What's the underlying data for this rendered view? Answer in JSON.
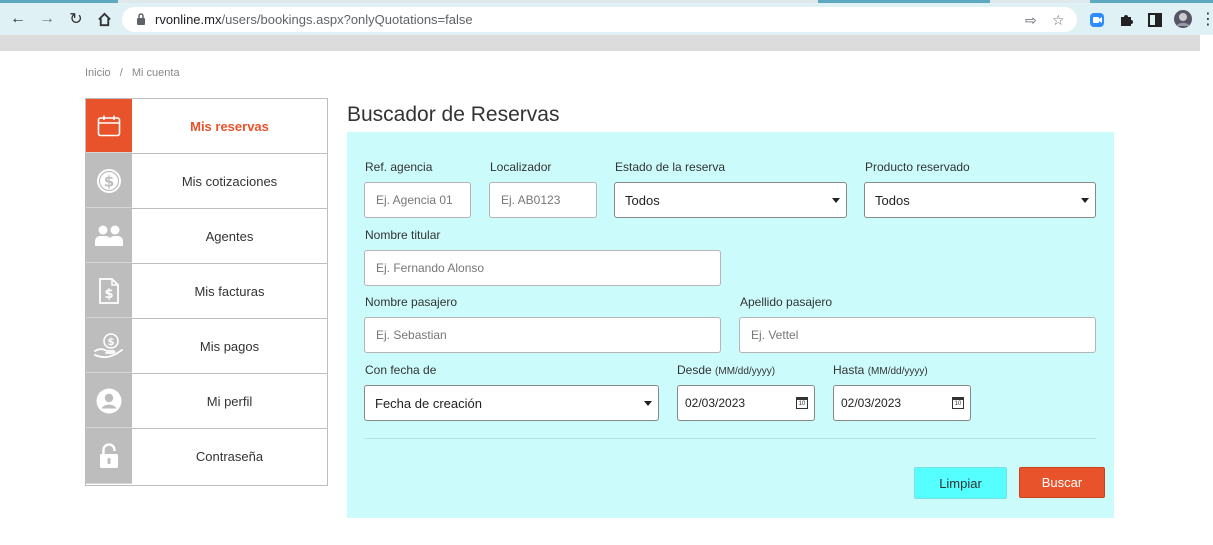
{
  "browser": {
    "url_host": "rvonline.mx",
    "url_path": "/users/bookings.aspx?onlyQuotations=false"
  },
  "breadcrumb": [
    "Inicio",
    "/",
    "Mi cuenta"
  ],
  "sidebar": {
    "items": [
      {
        "label": "Mis reservas",
        "icon": "calendar-icon",
        "active": true
      },
      {
        "label": "Mis cotizaciones",
        "icon": "dollar-coin-icon",
        "active": false
      },
      {
        "label": "Agentes",
        "icon": "people-icon",
        "active": false
      },
      {
        "label": "Mis facturas",
        "icon": "invoice-icon",
        "active": false
      },
      {
        "label": "Mis pagos",
        "icon": "hand-coin-icon",
        "active": false
      },
      {
        "label": "Mi perfil",
        "icon": "user-circle-icon",
        "active": false
      },
      {
        "label": "Contraseña",
        "icon": "lock-icon",
        "active": false
      }
    ]
  },
  "main": {
    "title": "Buscador de Reservas",
    "form": {
      "ref_agencia": {
        "label": "Ref. agencia",
        "placeholder": "Ej. Agencia 01"
      },
      "localizador": {
        "label": "Localizador",
        "placeholder": "Ej. AB0123"
      },
      "estado": {
        "label": "Estado de la reserva",
        "value": "Todos"
      },
      "producto": {
        "label": "Producto reservado",
        "value": "Todos"
      },
      "nombre_titular": {
        "label": "Nombre titular",
        "placeholder": "Ej. Fernando Alonso"
      },
      "nombre_pasajero": {
        "label": "Nombre pasajero",
        "placeholder": "Ej. Sebastian"
      },
      "apellido_pasajero": {
        "label": "Apellido pasajero",
        "placeholder": "Ej. Vettel"
      },
      "con_fecha": {
        "label": "Con fecha de",
        "value": "Fecha de creación"
      },
      "desde": {
        "label": "Desde",
        "format": "(MM/dd/yyyy)",
        "value": "02/03/2023"
      },
      "hasta": {
        "label": "Hasta",
        "format": "(MM/dd/yyyy)",
        "value": "02/03/2023"
      }
    },
    "buttons": {
      "clear": "Limpiar",
      "search": "Buscar"
    }
  },
  "colors": {
    "accent": "#e8532b",
    "panel": "#ccfbfb",
    "clear_button": "#55ffff"
  }
}
